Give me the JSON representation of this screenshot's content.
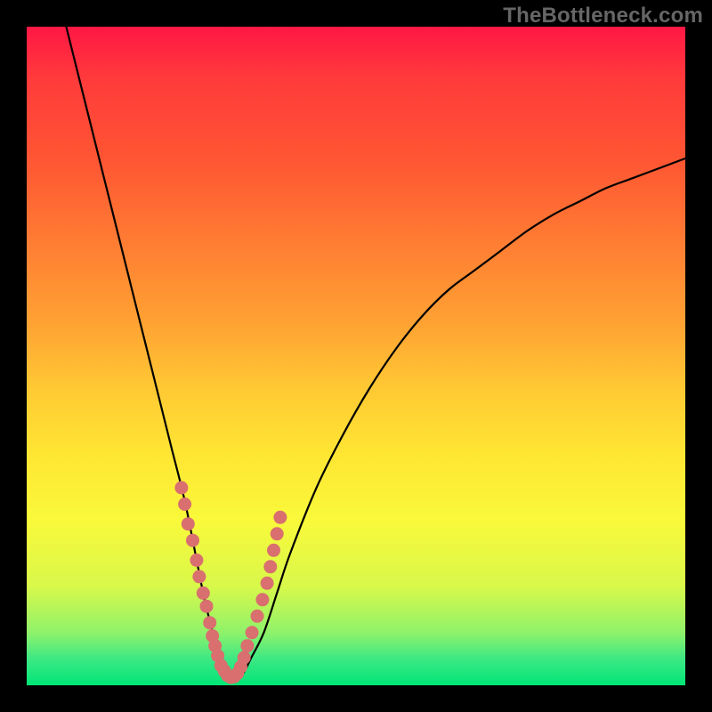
{
  "watermark": "TheBottleneck.com",
  "colors": {
    "frame_bg": "#000000",
    "curve_stroke": "#000000",
    "dot_fill": "#d96f6f",
    "gradient_top": "#ff1744",
    "gradient_bottom": "#00e676"
  },
  "chart_data": {
    "type": "line",
    "title": "",
    "xlabel": "",
    "ylabel": "",
    "xlim": [
      0,
      100
    ],
    "ylim": [
      0,
      100
    ],
    "grid": false,
    "legend": false,
    "note": "Values read from the figure by interpolating against the plot area; x is horizontal position (0=left edge of inner plot, 100=right edge), y is vertical position (0=bottom, 100=top).",
    "series": [
      {
        "name": "bottleneck-curve",
        "x": [
          6,
          8,
          10,
          12,
          14,
          16,
          18,
          20,
          22,
          24,
          26,
          27,
          28,
          29,
          30,
          31,
          32,
          33,
          34,
          36,
          38,
          40,
          44,
          48,
          52,
          56,
          60,
          64,
          68,
          72,
          76,
          80,
          84,
          88,
          92,
          96,
          100
        ],
        "y": [
          100,
          92,
          84,
          76,
          68,
          60,
          52,
          44,
          36,
          28,
          18,
          13,
          9,
          5,
          2,
          1,
          1,
          2,
          4,
          8,
          14,
          20,
          30,
          38,
          45,
          51,
          56,
          60,
          63,
          66,
          69,
          71.5,
          73.5,
          75.5,
          77,
          78.5,
          80
        ]
      },
      {
        "name": "highlight-dots",
        "x": [
          23.5,
          24.0,
          24.5,
          25.2,
          25.8,
          26.2,
          26.8,
          27.3,
          27.8,
          28.2,
          28.6,
          29.0,
          29.5,
          30.0,
          30.5,
          31.0,
          31.5,
          32.0,
          32.5,
          33.0,
          33.5,
          34.2,
          35.0,
          35.8,
          36.5,
          37.0,
          37.5,
          38.0,
          38.5
        ],
        "y": [
          30.0,
          27.5,
          24.5,
          22.0,
          19.0,
          16.5,
          14.0,
          12.0,
          9.5,
          7.5,
          6.0,
          4.5,
          3.0,
          2.2,
          1.5,
          1.2,
          1.3,
          1.8,
          2.8,
          4.2,
          6.0,
          8.0,
          10.5,
          13.0,
          15.5,
          18.0,
          20.5,
          23.0,
          25.5
        ]
      }
    ]
  }
}
